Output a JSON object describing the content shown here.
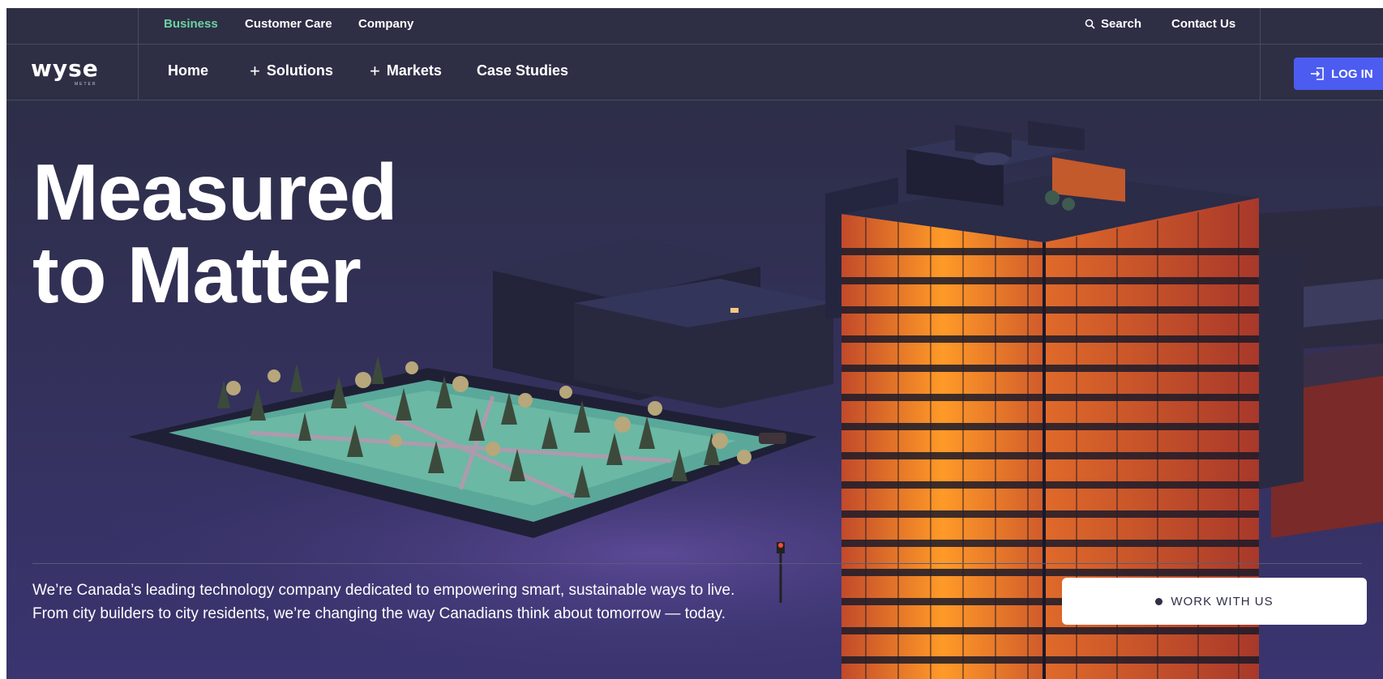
{
  "top_nav": {
    "business": "Business",
    "customer_care": "Customer Care",
    "company": "Company",
    "search": "Search",
    "contact": "Contact Us"
  },
  "logo": {
    "word": "wyse",
    "sub": "METER"
  },
  "main_nav": {
    "home": "Home",
    "solutions": "Solutions",
    "markets": "Markets",
    "case_studies": "Case Studies",
    "login": "LOG IN"
  },
  "hero": {
    "headline_line1": "Measured",
    "headline_line2": "to Matter",
    "tagline_line1": "We’re Canada’s leading technology company dedicated to empowering smart, sustainable ways to live.",
    "tagline_line2": "From city builders to city residents, we’re changing the way Canadians think about tomorrow — today.",
    "cta": "WORK WITH US"
  },
  "colors": {
    "background": "#2e2f45",
    "active_link": "#6cd3a0",
    "login_button": "#4c5cf0",
    "building_glow": "#ff8a1e"
  },
  "icons": {
    "search": "search-icon",
    "login": "login-icon",
    "plus": "plus-icon"
  }
}
